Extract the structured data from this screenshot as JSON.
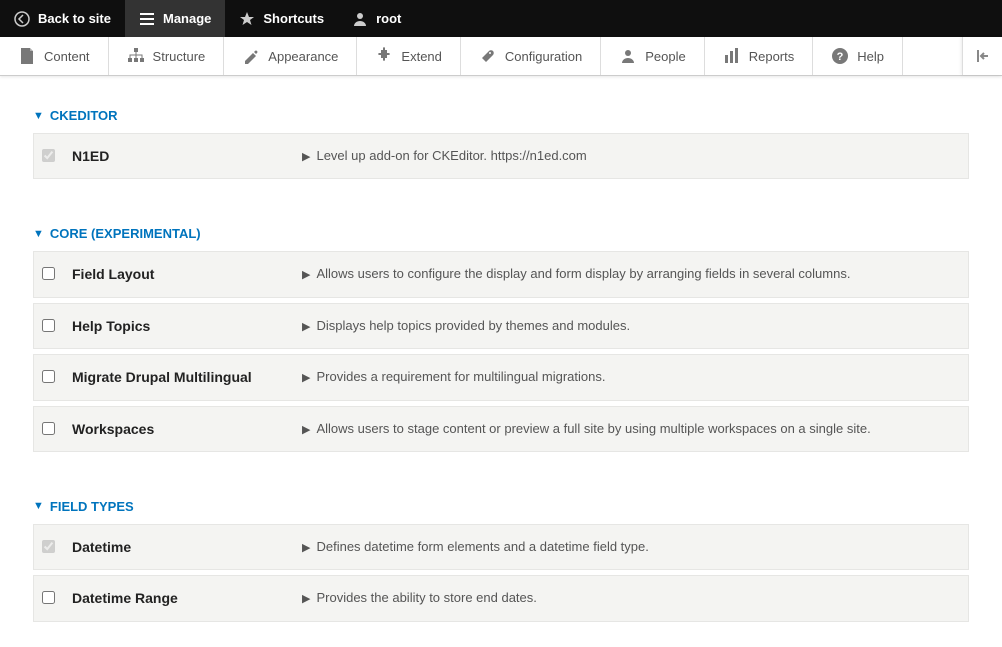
{
  "toolbar": {
    "back": "Back to site",
    "manage": "Manage",
    "shortcuts": "Shortcuts",
    "user": "root"
  },
  "tabs": {
    "content": "Content",
    "structure": "Structure",
    "appearance": "Appearance",
    "extend": "Extend",
    "configuration": "Configuration",
    "people": "People",
    "reports": "Reports",
    "help": "Help"
  },
  "groups": [
    {
      "title": "CKEDITOR",
      "modules": [
        {
          "name": "N1ED",
          "desc": "Level up add-on for CKEditor. https://n1ed.com",
          "checked": true,
          "disabled": true
        }
      ]
    },
    {
      "title": "CORE (EXPERIMENTAL)",
      "modules": [
        {
          "name": "Field Layout",
          "desc": "Allows users to configure the display and form display by arranging fields in several columns.",
          "checked": false,
          "disabled": false
        },
        {
          "name": "Help Topics",
          "desc": "Displays help topics provided by themes and modules.",
          "checked": false,
          "disabled": false
        },
        {
          "name": "Migrate Drupal Multilingual",
          "desc": "Provides a requirement for multilingual migrations.",
          "checked": false,
          "disabled": false
        },
        {
          "name": "Workspaces",
          "desc": "Allows users to stage content or preview a full site by using multiple workspaces on a single site.",
          "checked": false,
          "disabled": false
        }
      ]
    },
    {
      "title": "FIELD TYPES",
      "modules": [
        {
          "name": "Datetime",
          "desc": "Defines datetime form elements and a datetime field type.",
          "checked": true,
          "disabled": true
        },
        {
          "name": "Datetime Range",
          "desc": "Provides the ability to store end dates.",
          "checked": false,
          "disabled": false
        }
      ]
    }
  ]
}
